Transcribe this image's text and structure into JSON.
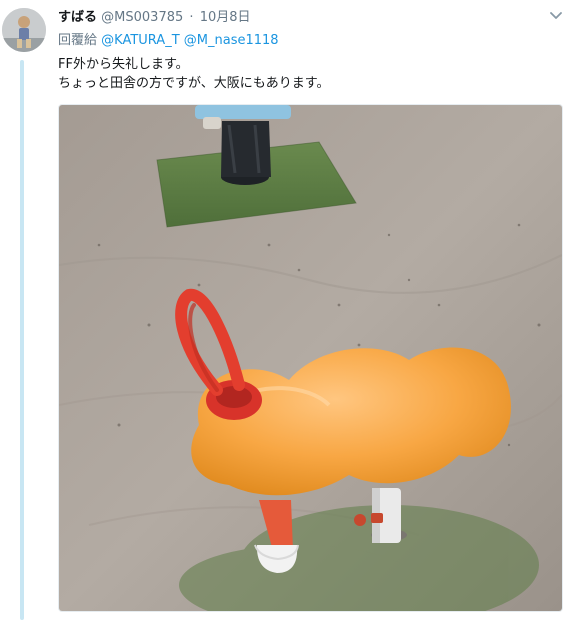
{
  "tweet": {
    "display_name": "すばる",
    "handle": "@MS003785",
    "separator": "·",
    "date": "10月8日",
    "reply_label": "回覆給",
    "reply_mentions": [
      "@KATURA_T",
      "@M_nase1118"
    ],
    "text_lines": [
      "FF外から失礼します。",
      "ちょっと田舎の方ですが、大阪にもあります。"
    ]
  },
  "icons": {
    "menu": "chevron-down-icon",
    "avatar": "avatar"
  },
  "colors": {
    "link": "#1b95e0",
    "thread_line": "#c8e6f3",
    "secondary_text": "#657786"
  }
}
